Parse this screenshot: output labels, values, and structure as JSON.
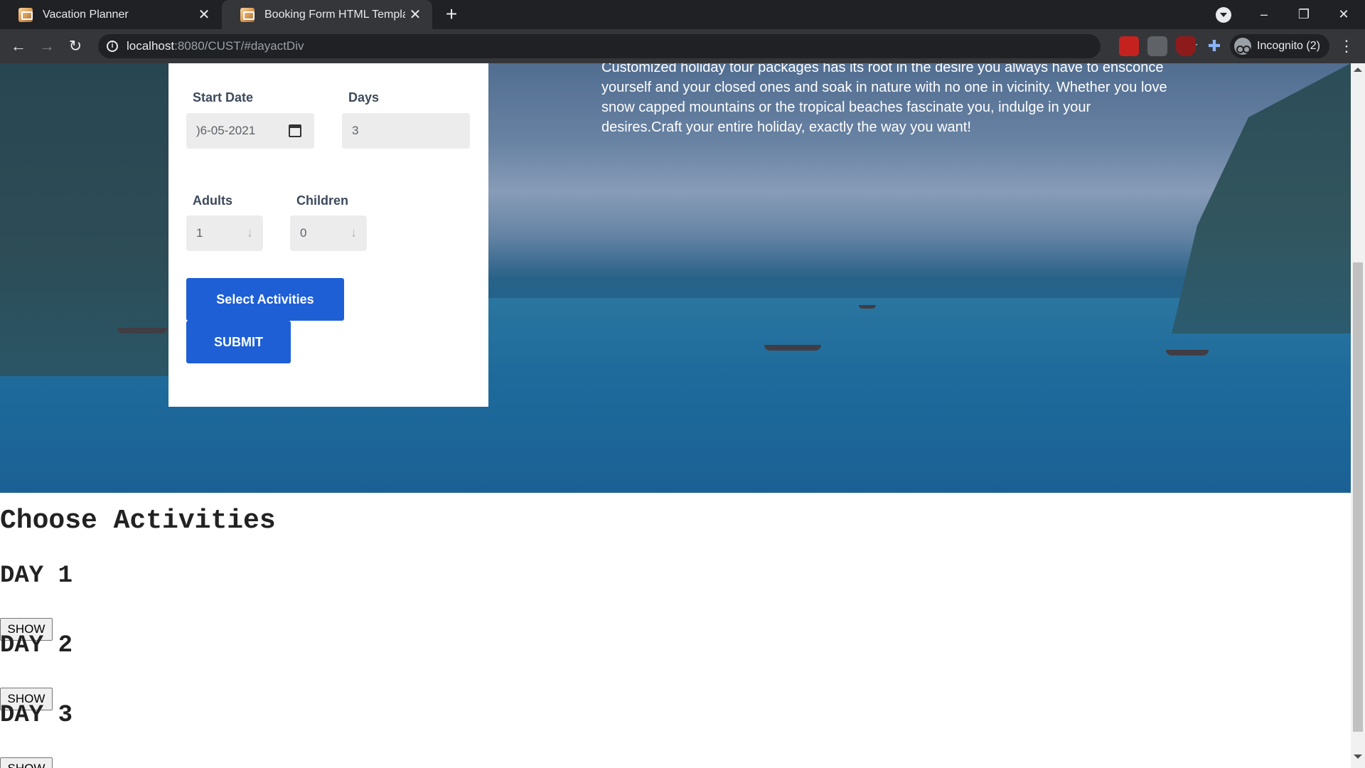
{
  "browser": {
    "tabs": [
      {
        "title": "Vacation Planner",
        "close": "✕",
        "active": false
      },
      {
        "title": "Booking Form HTML Template",
        "close": "✕",
        "active": true
      }
    ],
    "new_tab": "+",
    "window_controls": {
      "minimize": "–",
      "restore": "❐",
      "close": "✕"
    },
    "nav": {
      "back": "←",
      "forward": "→",
      "reload": "↻"
    },
    "url_host": "localhost",
    "url_rest": ":8080/CUST/#dayactDiv",
    "star": "☆",
    "profile_label": "Incognito (2)",
    "menu": "⋮"
  },
  "hero": {
    "description": "Customized holiday tour packages has its root in the desire you always have to ensconce yourself and your closed ones and soak in nature with no one in vicinity. Whether you love snow capped mountains or the tropical beaches fascinate you, indulge in your desires.Craft your entire holiday, exactly the way you want!"
  },
  "form": {
    "start_date_label": "Start Date",
    "start_date_value": ")6-05-2021",
    "days_label": "Days",
    "days_value": "3",
    "adults_label": "Adults",
    "adults_value": "1",
    "children_label": "Children",
    "children_value": "0",
    "select_activities_label": "Select Activities",
    "submit_label": "SUBMIT"
  },
  "activities": {
    "heading": "Choose Activities",
    "days": [
      {
        "title": "DAY 1",
        "button": "SHOW"
      },
      {
        "title": "DAY 2",
        "button": "SHOW"
      },
      {
        "title": "DAY 3",
        "button": "SHOW"
      }
    ]
  },
  "colors": {
    "accent_button": "#1e5fd6",
    "chrome_dark": "#202124",
    "chrome_toolbar": "#35363a"
  }
}
